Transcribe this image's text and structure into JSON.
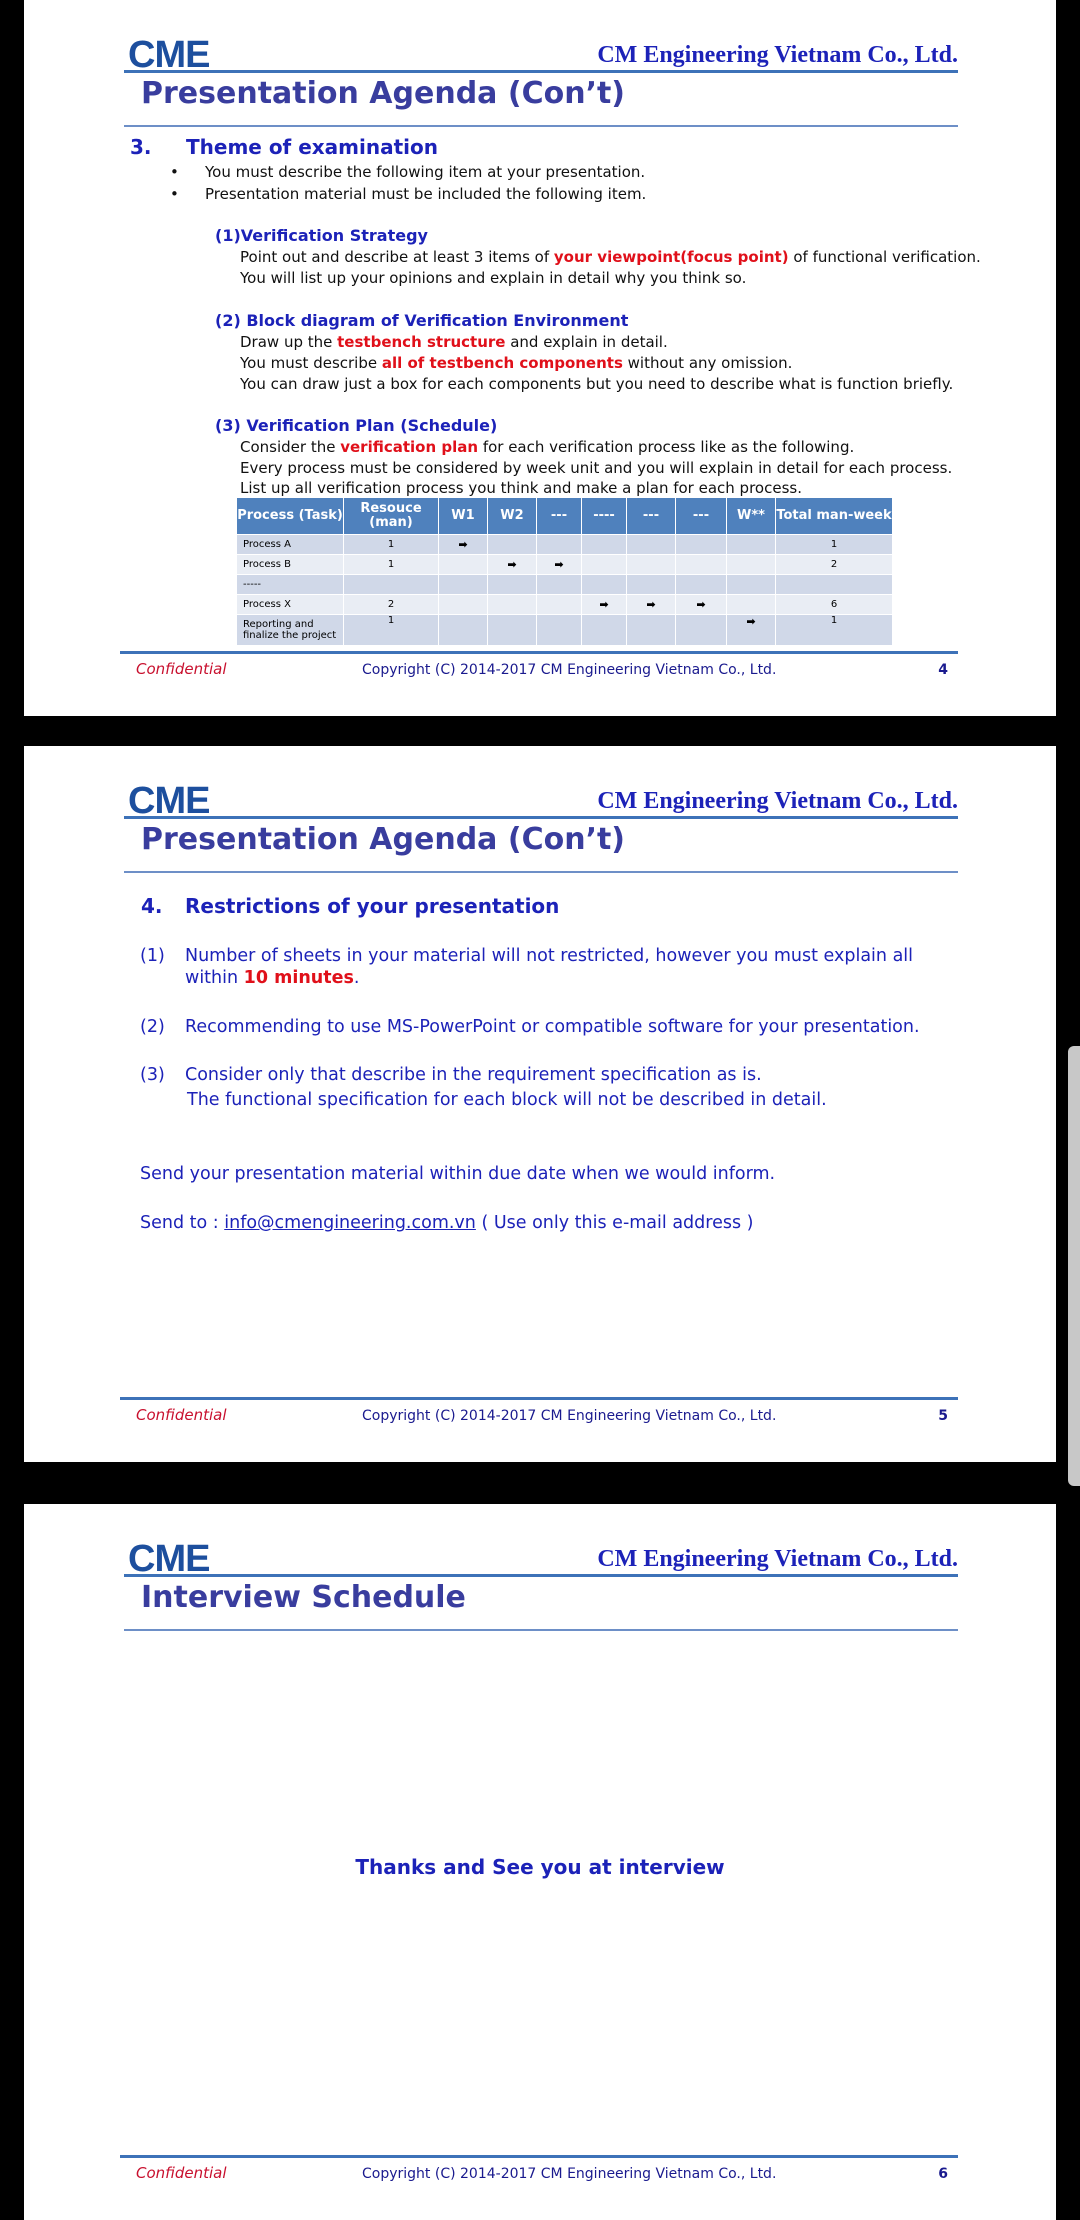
{
  "header": {
    "logo": "CME",
    "company": "CM Engineering Vietnam Co., Ltd."
  },
  "footer": {
    "confidential": "Confidential",
    "copyright": "Copyright (C) 2014-2017 CM Engineering Vietnam Co., Ltd."
  },
  "slide1": {
    "title": "Presentation Agenda (Con’t)",
    "section_num": "3.",
    "section_title": "Theme of examination",
    "bullets": [
      "You must describe the following item at your presentation.",
      "Presentation material must be included the following item."
    ],
    "item1": {
      "heading": "(1)Verification Strategy",
      "l1_a": "Point out and describe at least 3 items of ",
      "l1_red": "your viewpoint(focus point)",
      "l1_b": " of functional verification.",
      "l2": "You will  list up your opinions and explain in detail why you think so."
    },
    "item2": {
      "heading": "(2) Block diagram of Verification Environment",
      "l1_a": "Draw up the ",
      "l1_red": "testbench structure",
      "l1_b": " and explain in detail.",
      "l2_a": "You must describe ",
      "l2_red": "all of testbench components",
      "l2_b": " without any omission.",
      "l3": "You can draw just a box for each components but you need to describe what is function briefly."
    },
    "item3": {
      "heading": "(3) Verification Plan (Schedule)",
      "l1_a": "Consider the ",
      "l1_red": "verification plan",
      "l1_b": " for each verification process like as the following.",
      "l2": "Every process must be considered by week unit and you will explain in detail for each process.",
      "l3": "List up all verification process you think and make a plan for each process."
    },
    "table": {
      "headers": [
        "Process (Task)",
        "Resouce (man)",
        "W1",
        "W2",
        "---",
        "----",
        "---",
        "---",
        "W**",
        "Total man-week"
      ],
      "rows": [
        {
          "task": "Process A",
          "res": "1",
          "arrows": [
            0
          ],
          "total": "1"
        },
        {
          "task": "Process B",
          "res": "1",
          "arrows": [
            1,
            2
          ],
          "total": "2"
        },
        {
          "task": "-----",
          "res": "",
          "arrows": [],
          "total": ""
        },
        {
          "task": "Process X",
          "res": "2",
          "arrows": [
            3,
            4,
            5
          ],
          "total": "6"
        },
        {
          "task": "Reporting and finalize the project",
          "res": "1",
          "arrows": [
            6
          ],
          "total": "1"
        }
      ]
    },
    "page": "4"
  },
  "slide2": {
    "title": "Presentation Agenda (Con’t)",
    "section_num": "4.",
    "section_title": "Restrictions of your presentation",
    "r1_num": "(1)",
    "r1_a": "Number of sheets in your material will not restricted, however you must explain all",
    "r1_b": "within ",
    "r1_red": "10 minutes",
    "r1_c": ".",
    "r2_num": "(2)",
    "r2": "Recommending to use MS-PowerPoint or compatible software for your presentation.",
    "r3_num": "(3)",
    "r3_a": "Consider only that describe in the requirement specification as is.",
    "r3_b": "The functional specification for each block will not be described in detail.",
    "send1": "Send your presentation material within due date when we would inform.",
    "send_to": "Send to  : ",
    "email": "info@cmengineering.com.vn",
    "email_note": "  ( Use only this e-mail address )",
    "page": "5"
  },
  "slide3": {
    "title": "Interview Schedule",
    "message": "Thanks and See you at interview",
    "page": "6"
  }
}
